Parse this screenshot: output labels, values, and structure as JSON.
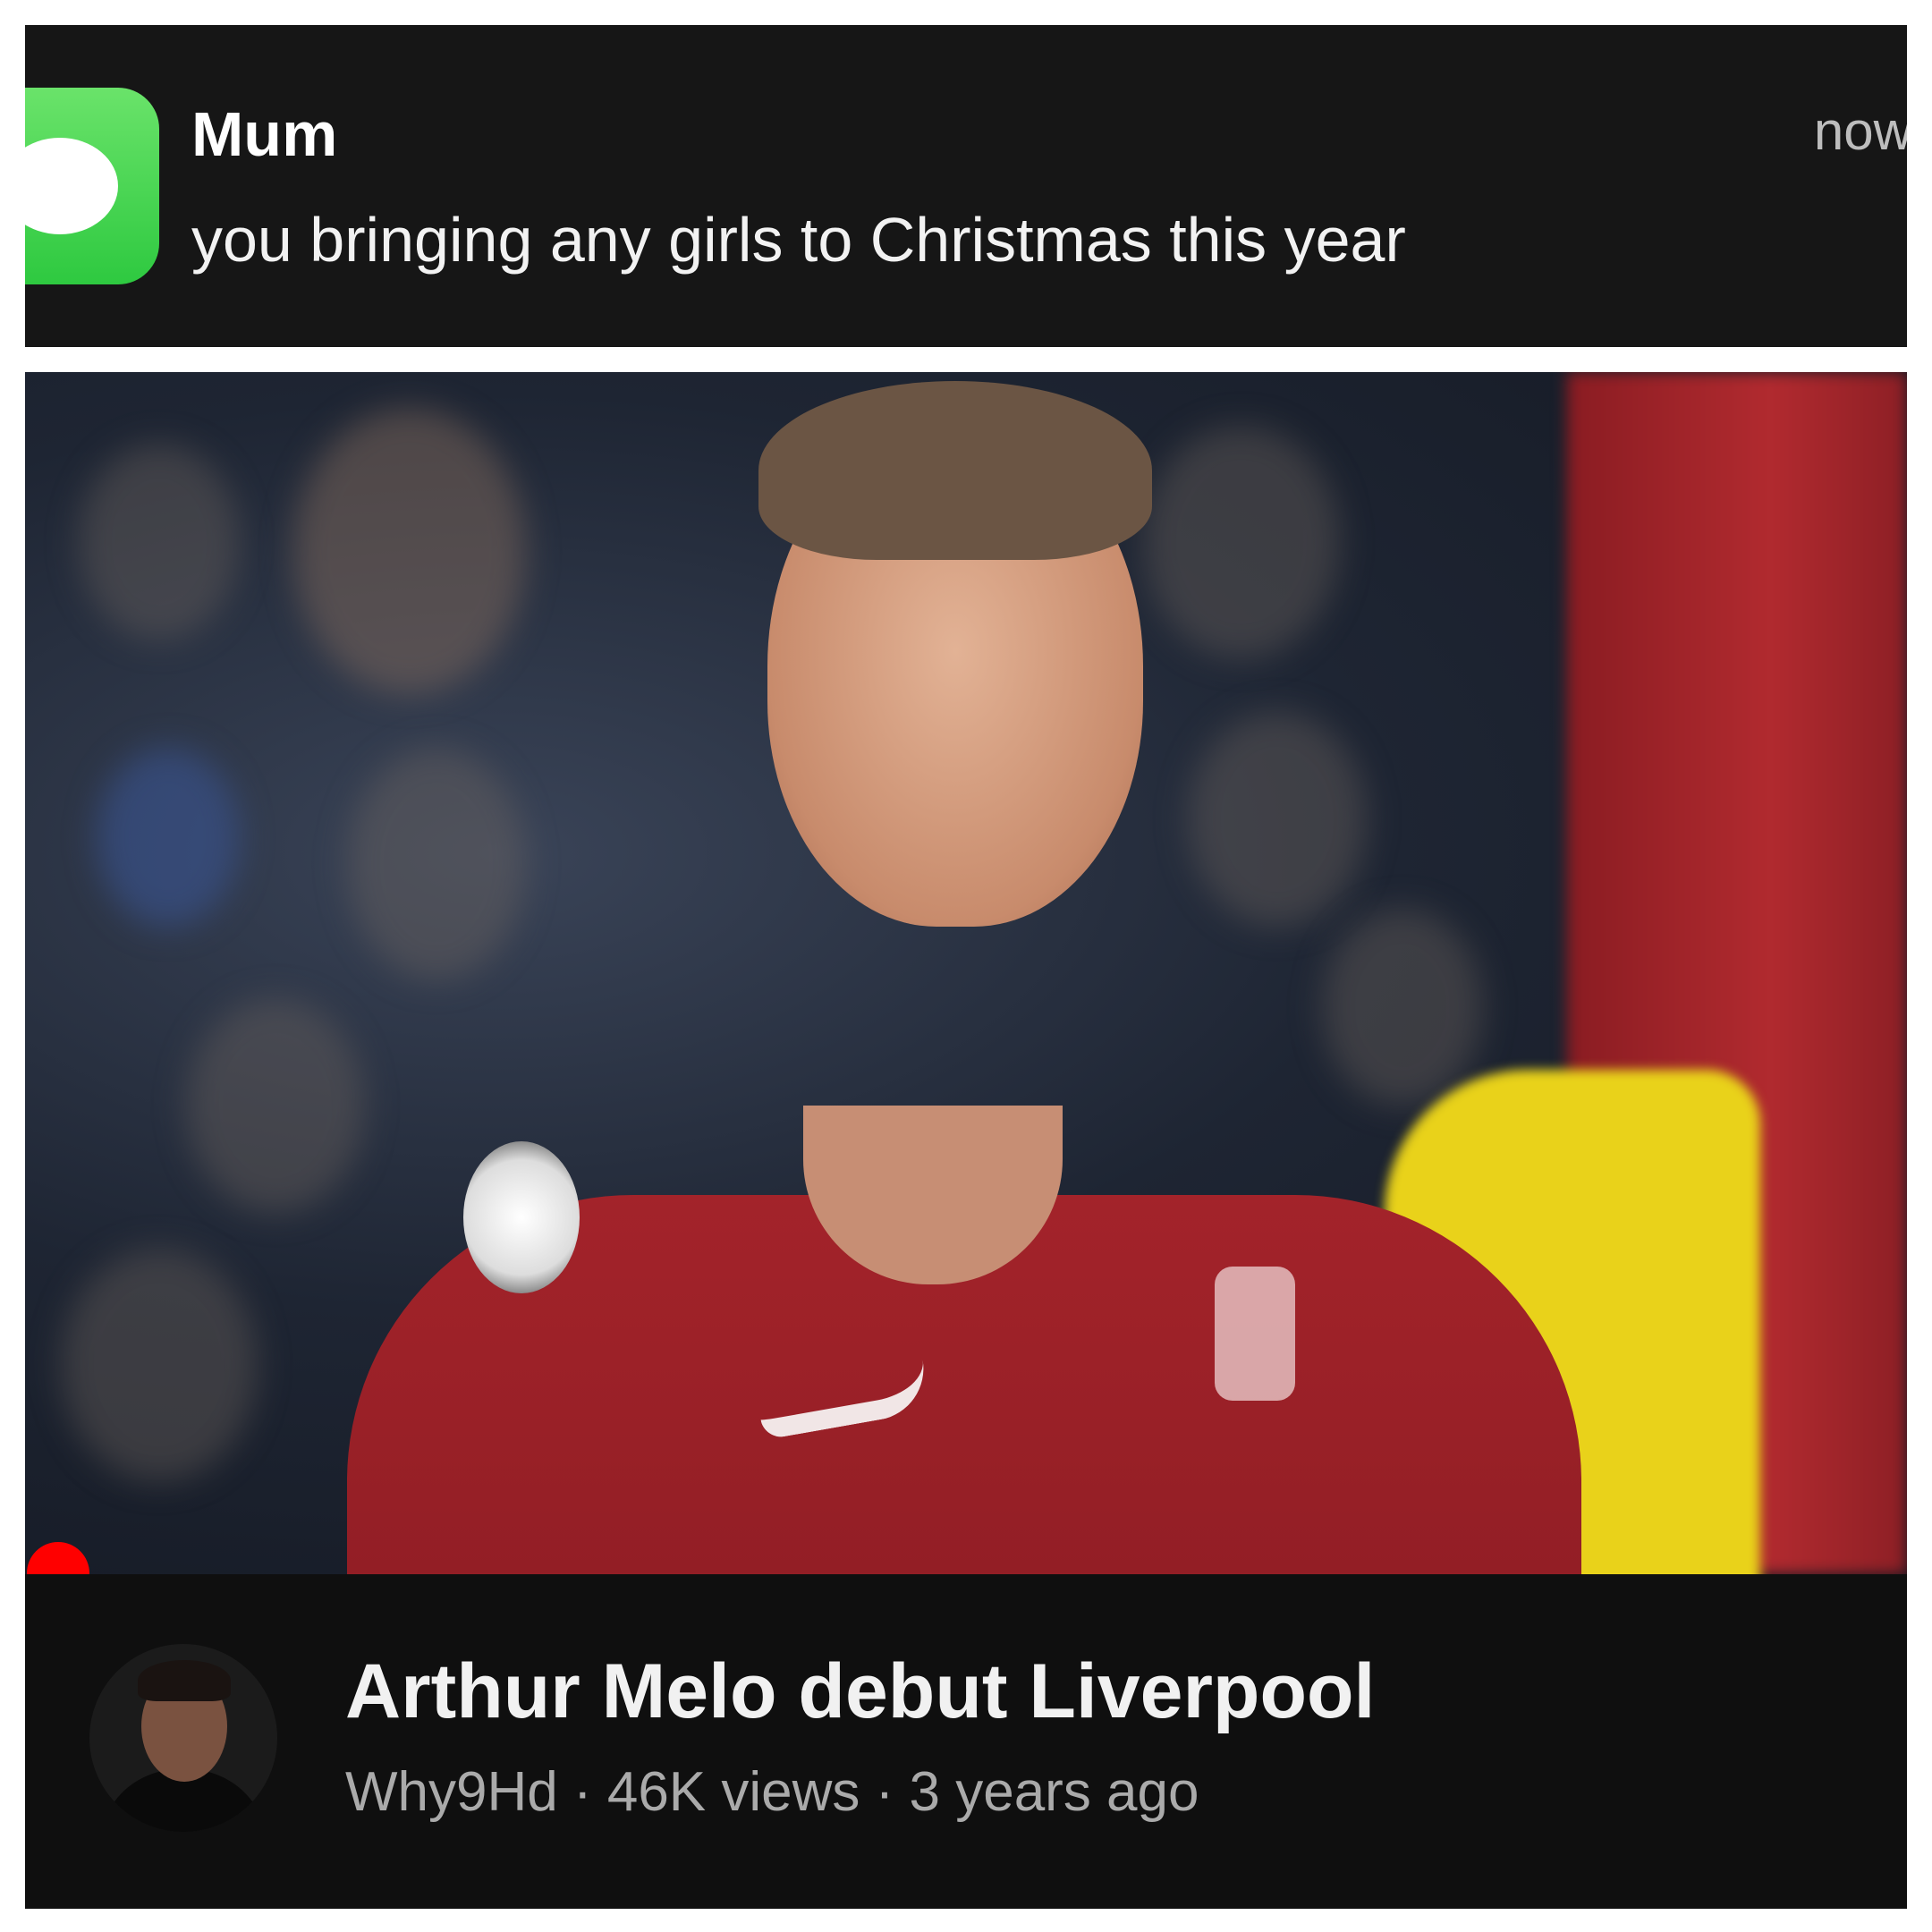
{
  "notification": {
    "app_icon": "messages-icon",
    "sender": "Mum",
    "message": "you bringing any girls to Christmas this year",
    "time": "now",
    "icon_color": "#34c759"
  },
  "video": {
    "thumbnail_icon": "video-thumbnail",
    "live_indicator_color": "#ff0000",
    "channel_avatar_icon": "channel-avatar",
    "title": "Arthur Melo debut Liverpool",
    "meta": "Why9Hd · 46K views · 3 years ago"
  }
}
